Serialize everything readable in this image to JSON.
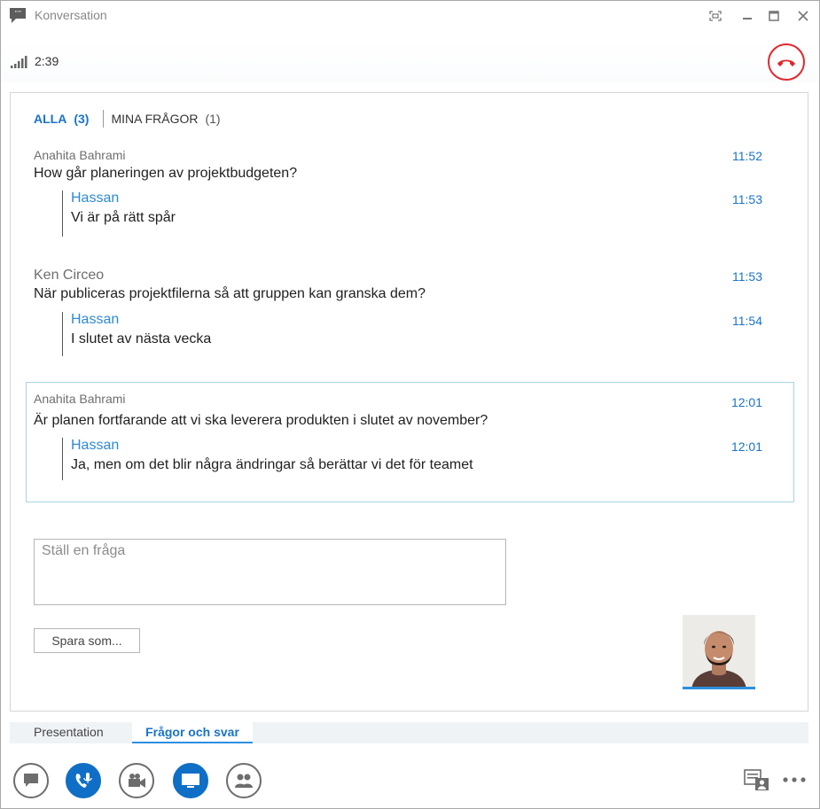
{
  "window": {
    "title": "Konversation"
  },
  "call": {
    "duration": "2:39"
  },
  "filters": {
    "all_label": "ALLA",
    "all_count": "(3)",
    "mine_label": "MINA FRÅGOR",
    "mine_count": "(1)"
  },
  "questions": [
    {
      "author": "Anahita Bahrami",
      "time": "11:52",
      "text": "How går planeringen av projektbudgeten?",
      "answer": {
        "author": "Hassan",
        "time": "11:53",
        "text": "Vi är på rätt spår"
      }
    },
    {
      "author": "Ken Circeo",
      "time": "11:53",
      "text": "När publiceras projektfilerna så att gruppen kan granska dem?",
      "answer": {
        "author": "Hassan",
        "time": "11:54",
        "text": "I slutet av nästa vecka"
      }
    },
    {
      "author": "Anahita Bahrami",
      "time": "12:01",
      "text": "Är planen fortfarande att vi ska leverera produkten i slutet av november?",
      "answer": {
        "author": "Hassan",
        "time": "12:01",
        "text": "Ja, men om det blir några ändringar så berättar vi det för teamet"
      }
    }
  ],
  "ask": {
    "placeholder": "Ställ en fråga"
  },
  "save_button": "Spara som...",
  "tabs": {
    "presentation": "Presentation",
    "qa": "Frågor och svar"
  },
  "colors": {
    "accent": "#1a73c9",
    "hangup": "#e0282e",
    "active_button": "#0f6fc6"
  },
  "icons": {
    "app": "chat-bubble-icon",
    "signal": "signal-strength-icon",
    "hangup": "hang-up-phone-icon",
    "toolbar": [
      "im-icon",
      "microphone-phone-icon",
      "video-camera-icon",
      "present-screen-icon",
      "participants-icon",
      "meeting-options-icon",
      "more-options-icon"
    ]
  }
}
